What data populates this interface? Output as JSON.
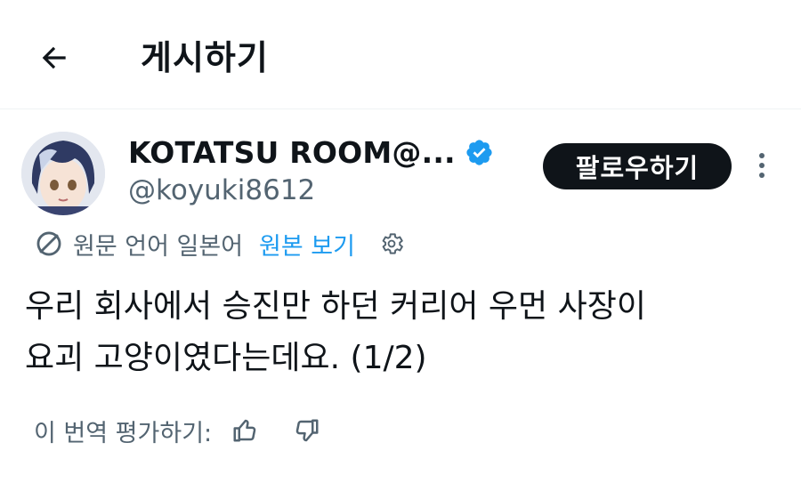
{
  "header": {
    "back_icon": "arrow-left-icon",
    "title": "게시하기"
  },
  "author": {
    "display_name": "KOTATSU ROOM@...",
    "handle": "@koyuki8612",
    "verified_icon": "verified-badge-icon",
    "verified_color": "#1d9bf0"
  },
  "actions": {
    "follow_label": "팔로우하기",
    "more_icon": "more-vertical-icon"
  },
  "translation": {
    "icon": "translate-icon",
    "source_text": "원문 언어 일본어",
    "view_original_label": "원본 보기",
    "settings_icon": "gear-icon",
    "link_color": "#1d9bf0"
  },
  "tweet": {
    "line1": "우리 회사에서 승진만 하던 커리어 우먼 사장이",
    "line2": "요괴 고양이였다는데요. (1/2)"
  },
  "rating": {
    "label": "이 번역 평가하기:",
    "thumbs_up_icon": "thumbs-up-icon",
    "thumbs_down_icon": "thumbs-down-icon"
  }
}
